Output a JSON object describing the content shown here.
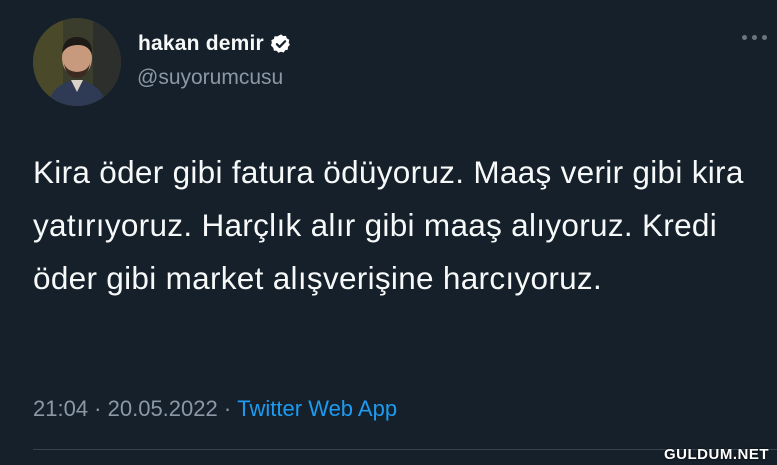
{
  "author": {
    "name": "hakan demir",
    "handle": "@suyorumcusu",
    "verified": true
  },
  "tweet": {
    "text": "Kira öder gibi fatura ödüyoruz. Maaş verir gibi kira yatırıyoruz. Harçlık alır gibi maaş alıyoruz. Kredi öder gibi market alışverişine harcıyoruz.",
    "time": "21:04",
    "date": "20.05.2022",
    "separator": " · ",
    "source": "Twitter Web App"
  },
  "watermark": "GULDUM.NET",
  "colors": {
    "background": "#15202b",
    "text": "#f7f9f9",
    "muted": "#8b98a5",
    "link": "#1d9bf0",
    "verified": "#ffffff"
  }
}
